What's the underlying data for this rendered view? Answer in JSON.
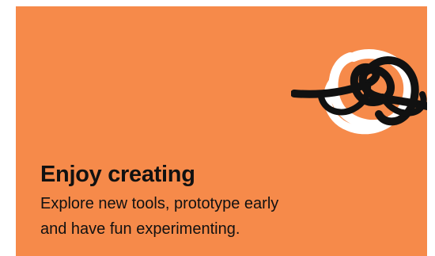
{
  "card": {
    "background_color": "#f68a4a",
    "illustration": "scribble-loop-icon",
    "title": "Enjoy creating",
    "description_line1": "Explore new tools, prototype early",
    "description_line2": "and have fun experimenting."
  }
}
